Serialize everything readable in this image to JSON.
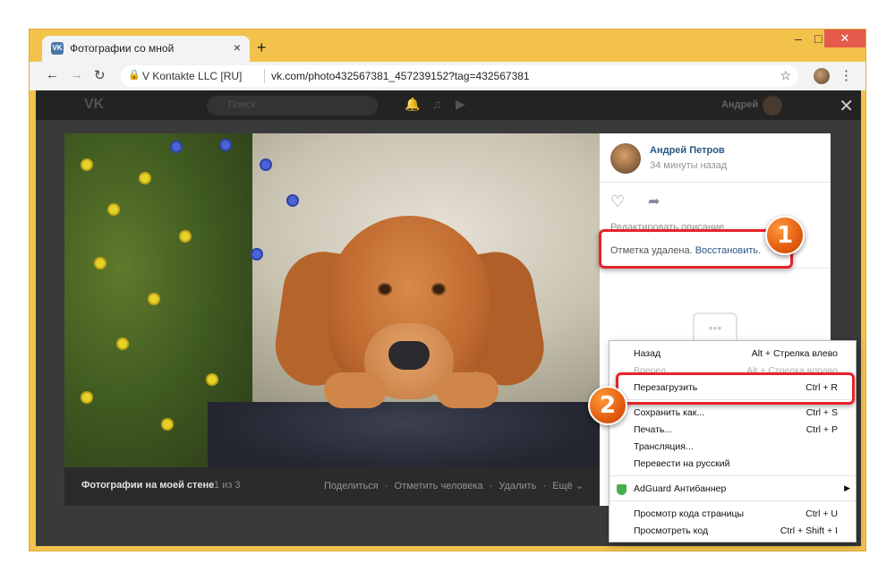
{
  "browser": {
    "tab_title": "Фотографии со мной",
    "tab_favicon": "VK",
    "tab_close": "×",
    "new_tab": "+",
    "win_min": "–",
    "win_max": "□",
    "win_close": "✕",
    "back": "←",
    "forward": "→",
    "reload": "↻",
    "site_info": "V Kontakte LLC [RU]",
    "url": "vk.com/photo432567381_457239152?tag=432567381",
    "star": "☆",
    "menu": "⋮"
  },
  "vk_header": {
    "logo": "VK",
    "search_placeholder": "Поиск",
    "user_name": "Андрей",
    "close_viewer": "✕"
  },
  "photo_bar": {
    "album_title": "Фотографии на моей стене",
    "counter": "1 из 3",
    "share": "Поделиться",
    "dot1": "·",
    "tag_person": "Отметить человека",
    "dot2": "·",
    "delete": "Удалить",
    "dot3": "·",
    "more": "Ещё ⌄"
  },
  "side_panel": {
    "author": "Андрей Петров",
    "time": "34 минуты назад",
    "like_icon": "♡",
    "share_icon": "➦",
    "edit_description": "Редактировать описание",
    "tag_removed": "Отметка удалена.",
    "restore": "Восстановить",
    "restore_dot": ".",
    "comments_icon": "•••"
  },
  "context_menu": {
    "items": [
      {
        "label": "Назад",
        "shortcut": "Alt + Стрелка влево"
      },
      {
        "label": "Вперед",
        "shortcut": "Alt + Стрелка вправо"
      },
      {
        "label": "Перезагрузить",
        "shortcut": "Ctrl + R"
      },
      {
        "label": "Сохранить как...",
        "shortcut": "Ctrl + S"
      },
      {
        "label": "Печать...",
        "shortcut": "Ctrl + P"
      },
      {
        "label": "Трансляция...",
        "shortcut": ""
      },
      {
        "label": "Перевести на русский",
        "shortcut": ""
      },
      {
        "label": "AdGuard Антибаннер",
        "shortcut": "▶"
      },
      {
        "label": "Просмотр кода страницы",
        "shortcut": "Ctrl + U"
      },
      {
        "label": "Просмотреть код",
        "shortcut": "Ctrl + Shift + I"
      }
    ]
  },
  "annotations": {
    "step1": "1",
    "step2": "2",
    "highlight_color": "#e8232a",
    "marker_color": "#e25d0f"
  }
}
